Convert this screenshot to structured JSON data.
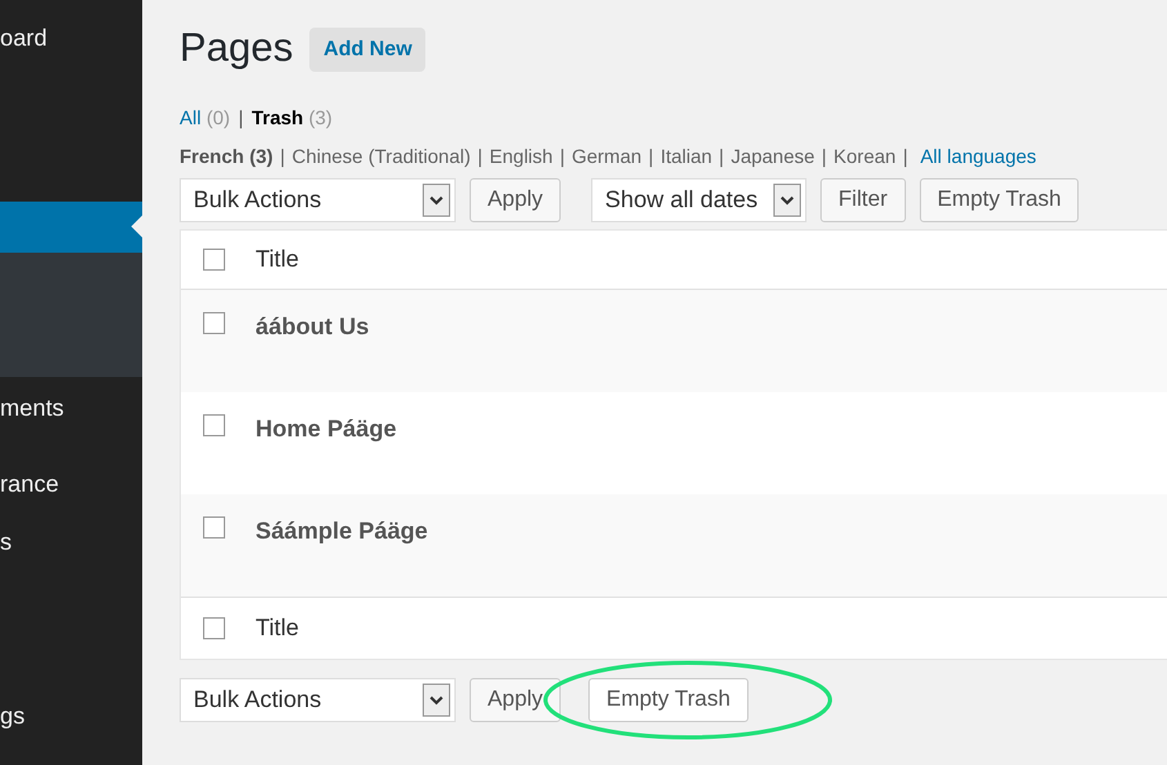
{
  "sidebar": {
    "items": [
      {
        "label": "oard",
        "selected": false
      },
      {
        "selected": true
      },
      {
        "label": "ments",
        "selected": false
      },
      {
        "label": "rance",
        "selected": false
      },
      {
        "label": "s",
        "selected": false
      },
      {
        "label": "gs",
        "selected": false
      }
    ]
  },
  "page": {
    "title": "Pages",
    "add_new": "Add New"
  },
  "status_links": [
    {
      "label": "All",
      "count": "(0)",
      "selected": false,
      "separator": "|"
    },
    {
      "label": "Trash",
      "count": "(3)",
      "selected": true
    }
  ],
  "language_links": [
    {
      "label": "French",
      "count": "(3)",
      "selected": true,
      "separator": "|"
    },
    {
      "label": "Chinese (Traditional)",
      "selected": false,
      "separator": "|"
    },
    {
      "label": "English",
      "selected": false,
      "separator": "|"
    },
    {
      "label": "German",
      "selected": false,
      "separator": "|"
    },
    {
      "label": "Italian",
      "selected": false,
      "separator": "|"
    },
    {
      "label": "Japanese",
      "selected": false,
      "separator": "|"
    },
    {
      "label": "Korean",
      "selected": false,
      "separator": "|"
    }
  ],
  "all_languages": "All languages",
  "top_controls": {
    "bulk_actions": "Bulk Actions",
    "apply": "Apply",
    "dates": "Show all dates",
    "filter": "Filter",
    "empty_trash": "Empty Trash"
  },
  "table": {
    "header": "Title",
    "header_checked": false,
    "footer_checked": false,
    "rows": [
      {
        "title": "áábout Us",
        "checked": false
      },
      {
        "title": "Home Páäge",
        "checked": false
      },
      {
        "title": "Sáámple Páäge",
        "checked": false
      }
    ],
    "footer": "Title"
  },
  "bottom_controls": {
    "bulk_actions": "Bulk Actions",
    "apply": "Apply",
    "empty_trash": "Empty Trash",
    "highlighted": true
  }
}
